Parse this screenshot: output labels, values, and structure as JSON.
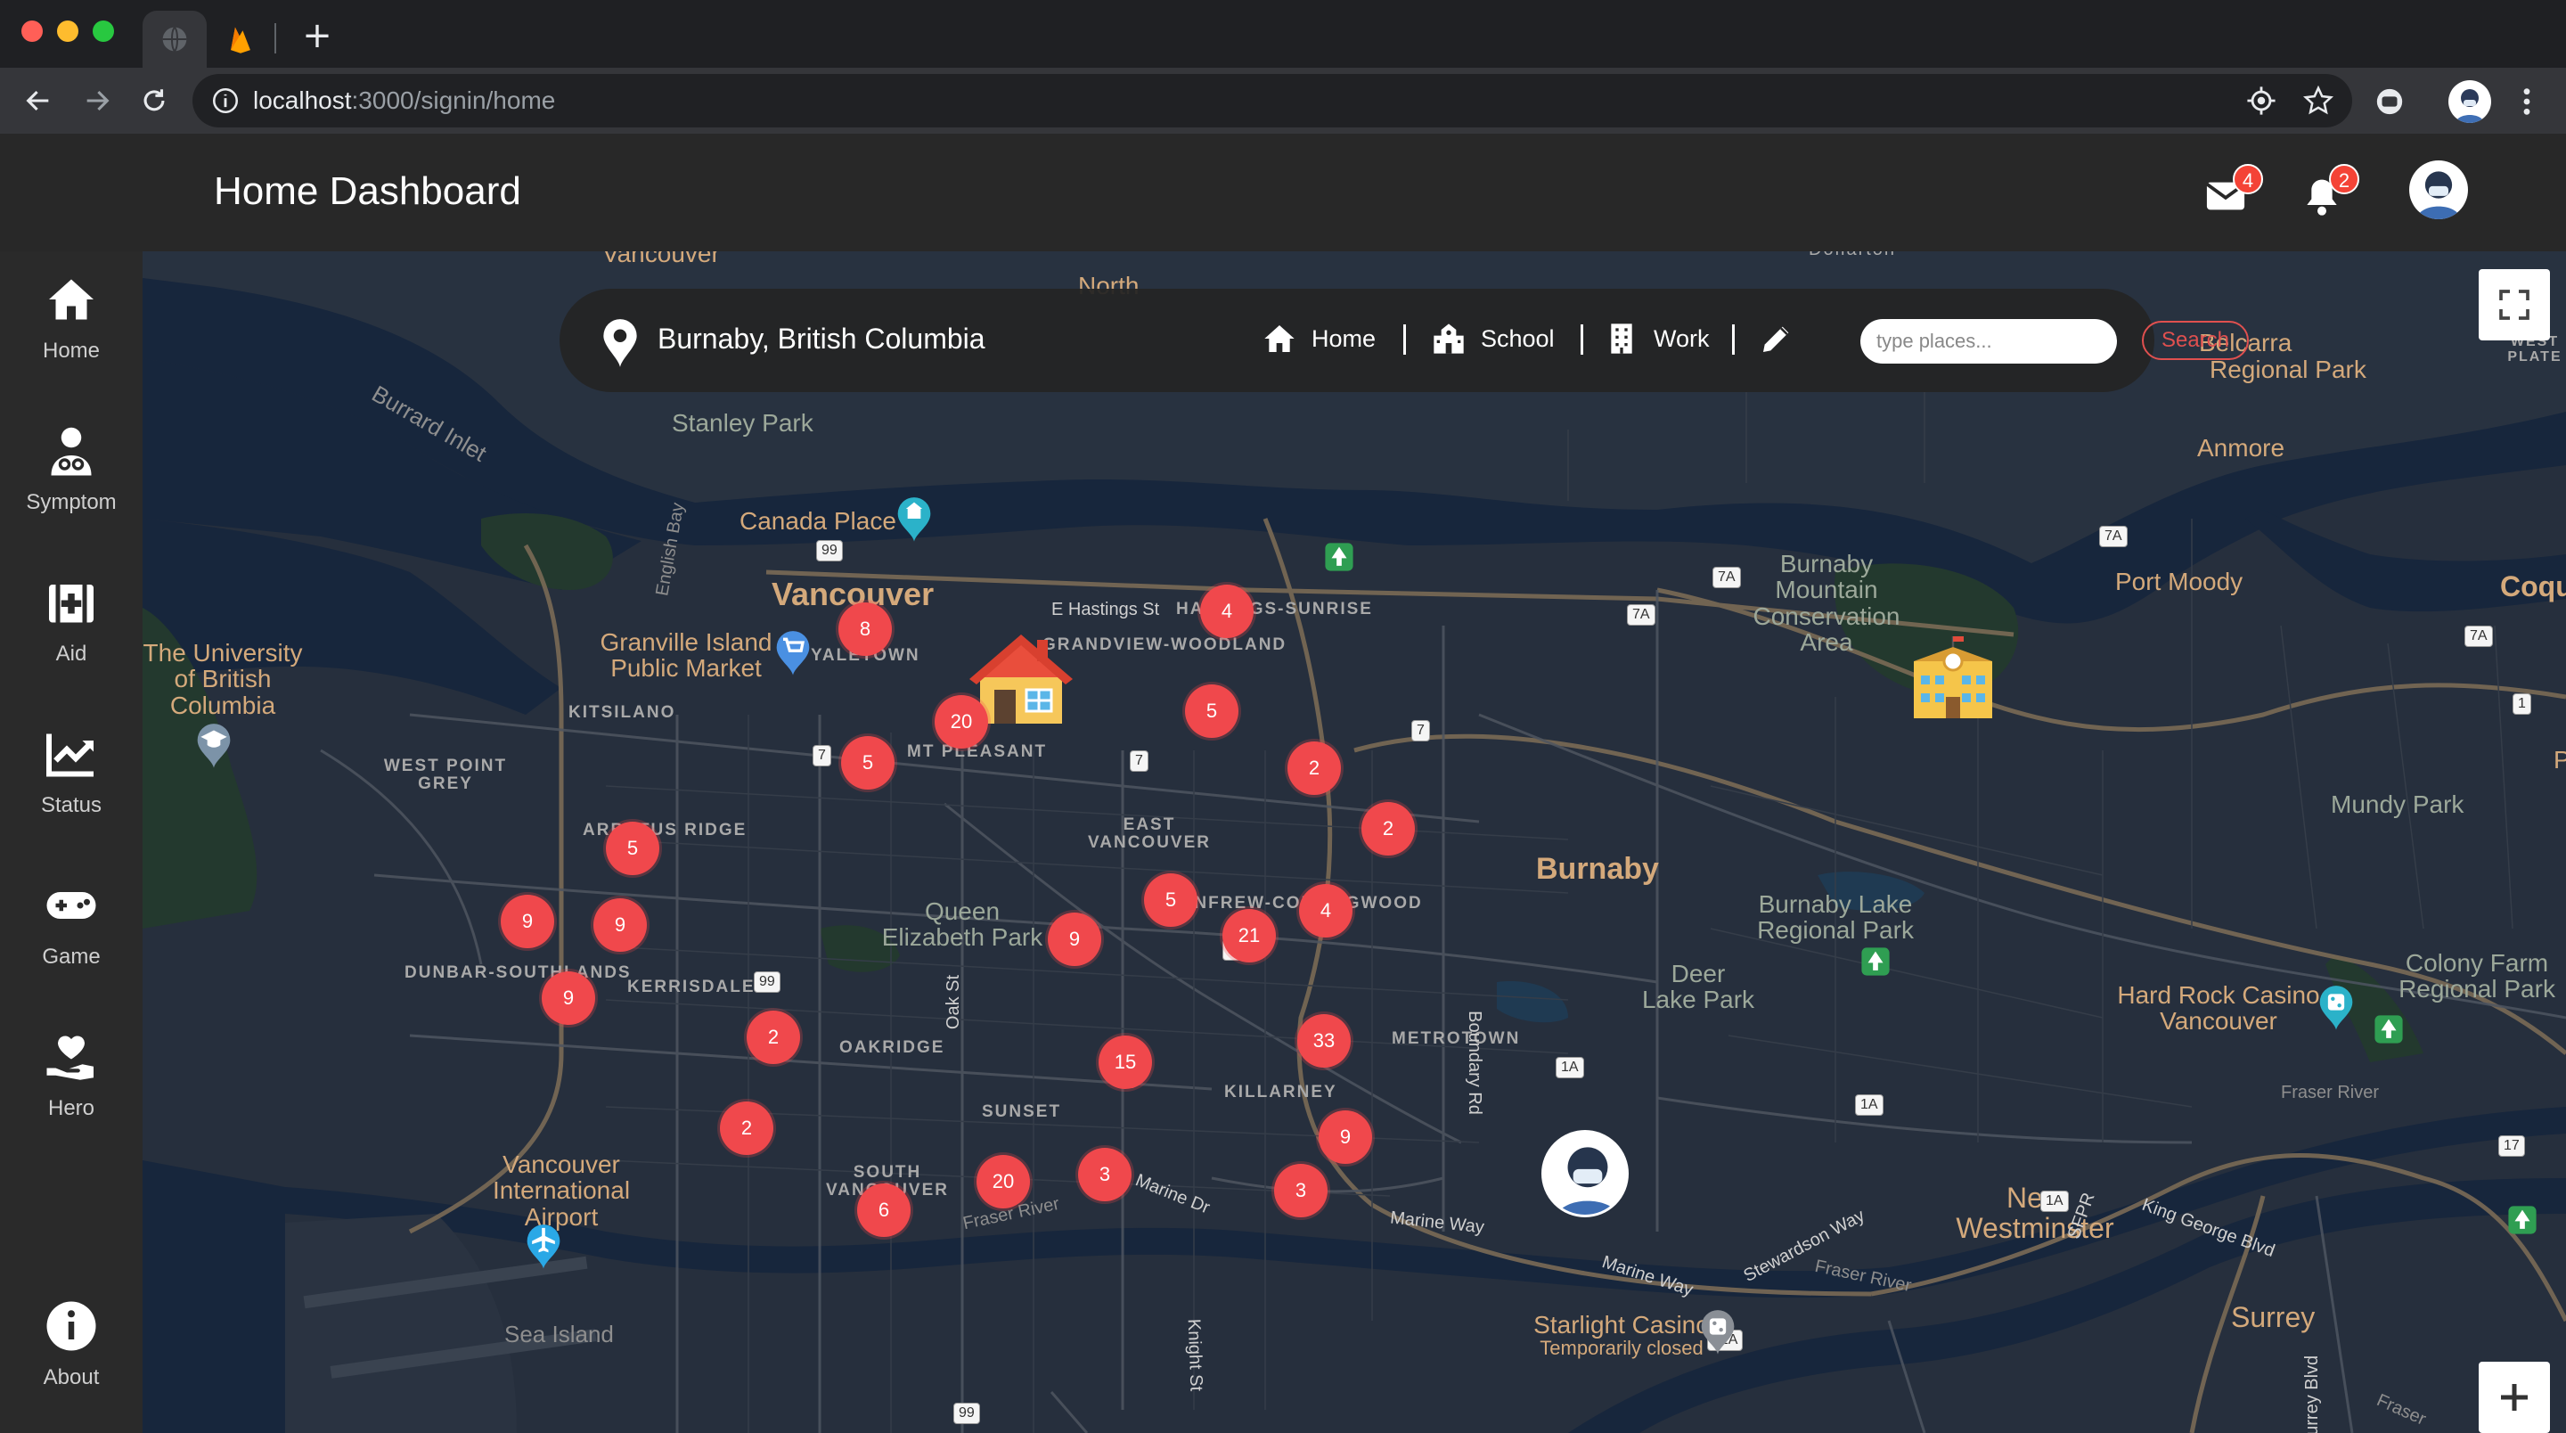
{
  "browser": {
    "url_host": "localhost",
    "url_path": ":3000/signin/home"
  },
  "header": {
    "title": "Home Dashboard",
    "mail_count": "4",
    "notification_count": "2"
  },
  "sidebar": {
    "items": [
      {
        "label": "Home",
        "icon": "home-icon"
      },
      {
        "label": "Symptom",
        "icon": "doctor-icon"
      },
      {
        "label": "Aid",
        "icon": "first-aid-icon"
      },
      {
        "label": "Status",
        "icon": "chart-icon"
      },
      {
        "label": "Game",
        "icon": "gamepad-icon"
      },
      {
        "label": "Hero",
        "icon": "hand-heart-icon"
      },
      {
        "label": "About",
        "icon": "info-icon"
      }
    ]
  },
  "searchbar": {
    "location": "Burnaby, British Columbia",
    "tabs": [
      "Home",
      "School",
      "Work"
    ],
    "placeholder": "type places...",
    "search_label": "Search"
  },
  "map": {
    "places": {
      "vancouver": "Vancouver",
      "burnaby": "Burnaby",
      "new_westminster": "New Westminster",
      "surrey": "Surrey",
      "port_moody": "Port Moody",
      "anmore": "Anmore",
      "belcarra": "Belcarra",
      "regional_park": "Regional Park",
      "coquitlam": "Coqu",
      "stanley_park": "Stanley Park",
      "canada_place": "Canada Place",
      "granville_1": "Granville Island",
      "granville_2": "Public Market",
      "ubc_1": "The University",
      "ubc_2": "of British",
      "ubc_3": "Columbia",
      "qe_1": "Queen",
      "qe_2": "Elizabeth Park",
      "bm_1": "Burnaby",
      "bm_2": "Mountain",
      "bm_3": "Conservation",
      "bm_4": "Area",
      "bl_1": "Burnaby Lake",
      "bl_2": "Regional Park",
      "dl_1": "Deer",
      "dl_2": "Lake Park",
      "mundy": "Mundy Park",
      "cf_1": "Colony Farm",
      "cf_2": "Regional Park",
      "hr_1": "Hard Rock Casino",
      "hr_2": "Vancouver",
      "yvr_1": "Vancouver",
      "yvr_2": "International",
      "yvr_3": "Airport",
      "sea_island": "Sea Island",
      "starlight_1": "Starlight Casino",
      "starlight_2": "Temporarily closed",
      "kitsilano": "KITSILANO",
      "wpg_1": "WEST POINT",
      "wpg_2": "GREY",
      "arbutus": "ARBUTUS RIDGE",
      "dunbar": "DUNBAR-SOUTHLANDS",
      "kerrisdale": "KERRISDALE",
      "oakridge": "OAKRIDGE",
      "sunset": "SUNSET",
      "killarney": "KILLARNEY",
      "metrotown": "METROTOWN",
      "ev_1": "EAST",
      "ev_2": "VANCOUVER",
      "sv_1": "SOUTH",
      "sv_2": "VANCOUVER",
      "mt_pleasant": "MT PLEASANT",
      "renfrew": "RENFREW-COLLINGWOOD",
      "hastings": "HASTINGS-SUNRISE",
      "grandview": "GRANDVIEW-WOODLAND",
      "yaletown": "YALETOWN",
      "burrard_inlet": "Burrard Inlet",
      "english_bay": "English Bay",
      "north": "North",
      "e_hastings": "E Hastings St",
      "oak_st": "Oak St",
      "knight_st": "Knight St",
      "boundary_rd": "Boundary Rd",
      "marine_dr": "Marine Dr",
      "marine_way": "Marine Way",
      "marine_way2": "Marine Way",
      "stewardson": "Stewardson Way",
      "king_george": "King George Blvd",
      "fraser_river": "Fraser River",
      "fraser_river2": "Fraser River",
      "fraser_river3": "Fraser River",
      "sfpr": "SFPR",
      "west_plate": "WEST",
      "west_plate2": "PLATE",
      "port_m2": "P",
      "fraser_east": "Fraser",
      "north_van": "Vancouver",
      "vanc_top": "Vancouver",
      "dollarton": "Dollarton",
      "surrey_blvd": "Surrey Blvd"
    },
    "clusters": [
      "8",
      "4",
      "20",
      "5",
      "5",
      "2",
      "2",
      "5",
      "9",
      "9",
      "9",
      "5",
      "4",
      "21",
      "9",
      "2",
      "2",
      "15",
      "33",
      "9",
      "3",
      "20",
      "6",
      "3"
    ],
    "shields": [
      "99",
      "7A",
      "7A",
      "7A",
      "7A",
      "7",
      "7",
      "7",
      "1A",
      "1A",
      "1A",
      "99",
      "1",
      "17",
      "91A",
      "99",
      "1"
    ]
  }
}
